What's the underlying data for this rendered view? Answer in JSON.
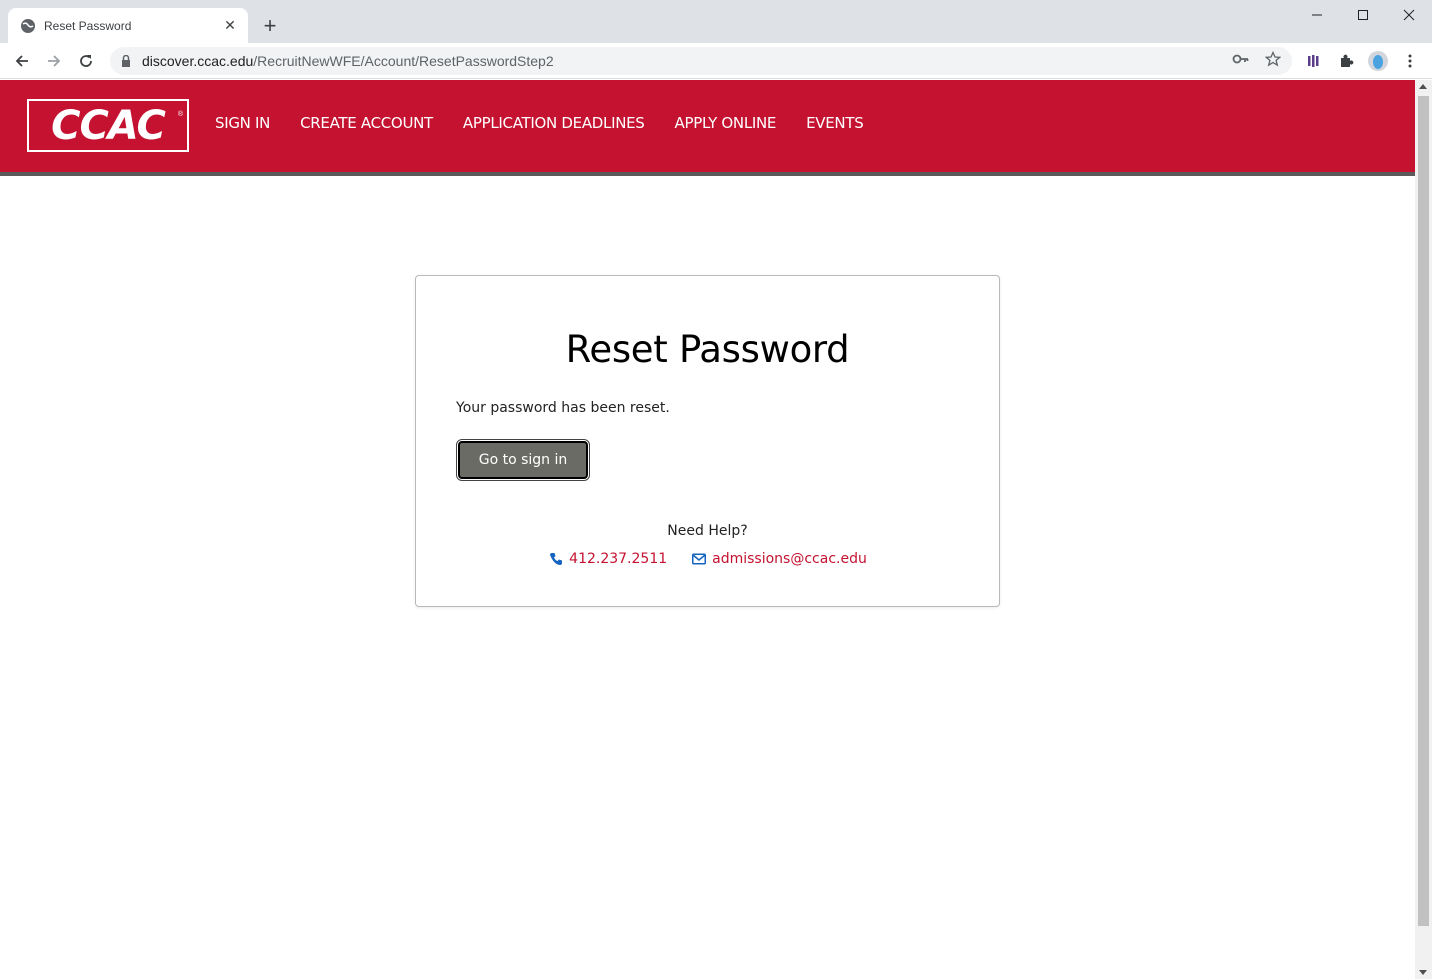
{
  "browser": {
    "tab_title": "Reset Password",
    "url_host": "discover.ccac.edu",
    "url_path": "/RecruitNewWFE/Account/ResetPasswordStep2"
  },
  "site": {
    "logo_text": "CCAC",
    "brand_color": "#c41230",
    "nav": [
      {
        "label": "SIGN IN"
      },
      {
        "label": "CREATE ACCOUNT"
      },
      {
        "label": "APPLICATION DEADLINES"
      },
      {
        "label": "APPLY ONLINE"
      },
      {
        "label": "EVENTS"
      }
    ]
  },
  "card": {
    "title": "Reset Password",
    "message": "Your password has been reset.",
    "button_label": "Go to sign in",
    "help_label": "Need Help?",
    "phone": "412.237.2511",
    "email": "admissions@ccac.edu"
  },
  "icons": {
    "phone": "phone-icon",
    "email": "envelope-icon",
    "tab_favicon": "globe-icon"
  }
}
